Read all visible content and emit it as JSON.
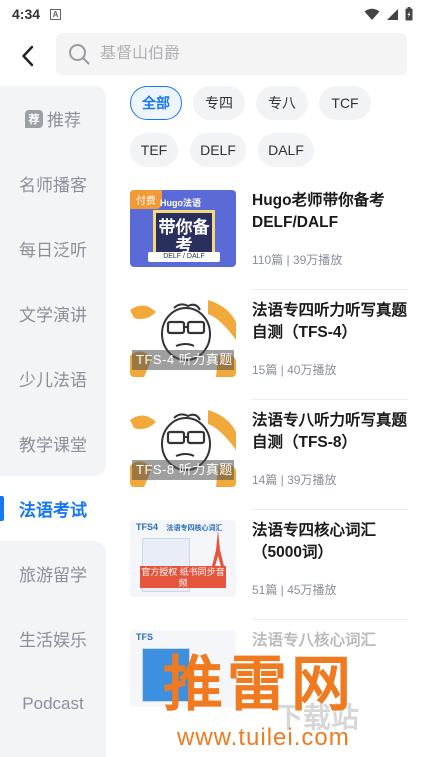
{
  "status_bar": {
    "time": "4:34",
    "notification_letter": "A",
    "icons": [
      "wifi-icon",
      "signal-icon",
      "battery-icon"
    ]
  },
  "header": {
    "back_icon": "back-arrow-icon",
    "search_placeholder": "基督山伯爵",
    "search_icon": "search-icon"
  },
  "sidebar": {
    "items": [
      {
        "label": "推荐",
        "tag": "荐",
        "active": false
      },
      {
        "label": "名师播客",
        "active": false
      },
      {
        "label": "每日泛听",
        "active": false
      },
      {
        "label": "文学演讲",
        "active": false
      },
      {
        "label": "少儿法语",
        "active": false
      },
      {
        "label": "教学课堂",
        "active": false
      },
      {
        "label": "法语考试",
        "active": true
      },
      {
        "label": "旅游留学",
        "active": false
      },
      {
        "label": "生活娱乐",
        "active": false
      },
      {
        "label": "Podcast",
        "active": false
      }
    ]
  },
  "filters": {
    "chips": [
      {
        "label": "全部",
        "active": true
      },
      {
        "label": "专四",
        "active": false
      },
      {
        "label": "专八",
        "active": false
      },
      {
        "label": "TCF",
        "active": false
      },
      {
        "label": "TEF",
        "active": false
      },
      {
        "label": "DELF",
        "active": false
      },
      {
        "label": "DALF",
        "active": false
      }
    ]
  },
  "list": {
    "items": [
      {
        "title": "Hugo老师带你备考DELF/DALF",
        "meta": "110篇 | 39万播放",
        "cover": {
          "badge": "付费",
          "brand": "Hugo法语",
          "board_text": "带你备考",
          "strip": "DELF / DALF"
        }
      },
      {
        "title": "法语专四听力听写真题自测（TFS-4）",
        "meta": "15篇 | 40万播放",
        "cover": {
          "label": "TFS-4 听力真题"
        }
      },
      {
        "title": "法语专八听力听写真题自测（TFS-8）",
        "meta": "14篇 | 39万播放",
        "cover": {
          "label": "TFS-8 听力真题"
        }
      },
      {
        "title": "法语专四核心词汇（5000词）",
        "meta": "51篇 | 45万播放",
        "cover": {
          "top": "TFS4",
          "top_title": "法语专四核心词汇",
          "banner": "官方授权 纸书同步音频"
        }
      },
      {
        "title": "法语专八核心词汇",
        "meta": "",
        "cover": {
          "top": "TFS"
        }
      }
    ]
  },
  "watermark": {
    "big": "推雷网",
    "url": "www.tuilei.com",
    "ghost": "下载站"
  },
  "colors": {
    "accent": "#1677f2",
    "sidebar_bg": "#f3f4f6",
    "chip_bg": "#f2f3f5",
    "watermark": "#ef7a20"
  }
}
